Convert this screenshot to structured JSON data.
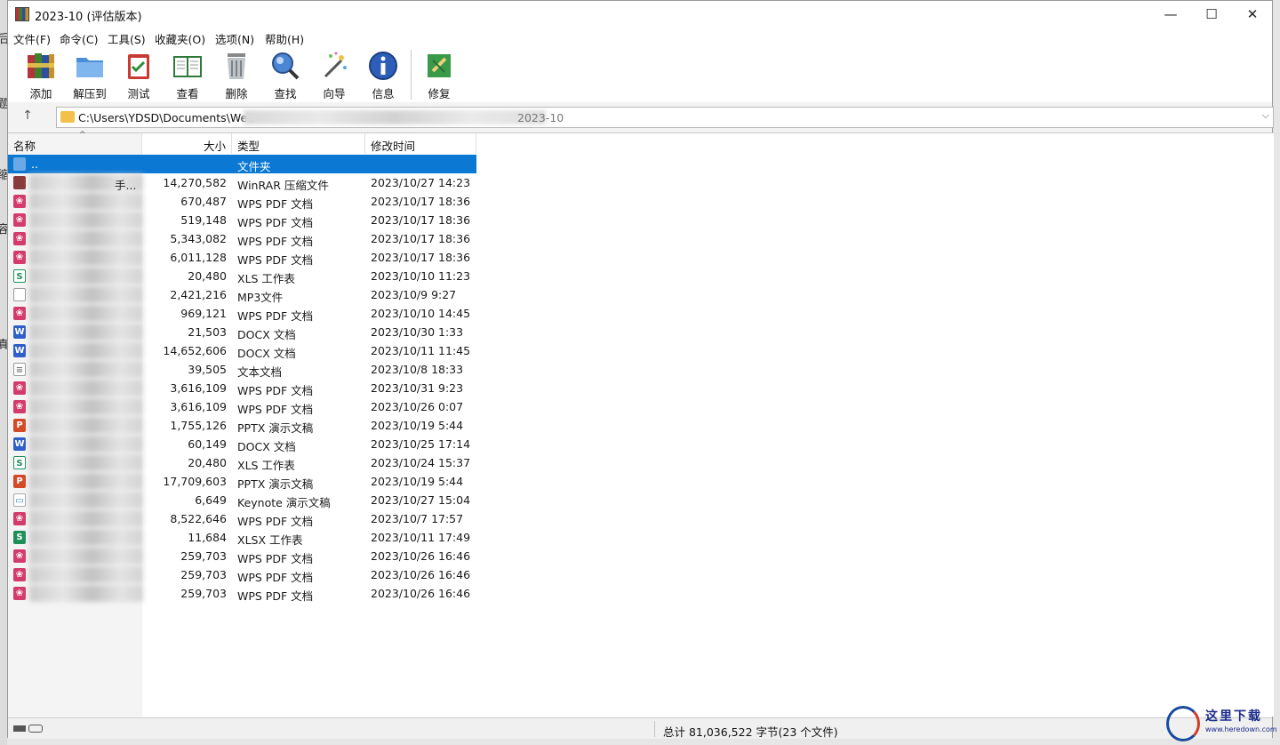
{
  "window": {
    "title": "2023-10 (评估版本)",
    "controls": {
      "minimize": "—",
      "maximize": "☐",
      "close": "✕"
    }
  },
  "background_chars": [
    "后",
    "题",
    "缩",
    "容",
    "真"
  ],
  "menu": [
    "文件(F)",
    "命令(C)",
    "工具(S)",
    "收藏夹(O)",
    "选项(N)",
    "帮助(H)"
  ],
  "toolbar": [
    {
      "label": "添加",
      "icon": "winrar-books-icon"
    },
    {
      "label": "解压到",
      "icon": "extract-folder-icon"
    },
    {
      "label": "测试",
      "icon": "test-clipboard-icon"
    },
    {
      "label": "查看",
      "icon": "view-book-icon"
    },
    {
      "label": "删除",
      "icon": "trash-icon"
    },
    {
      "label": "查找",
      "icon": "search-magnifier-icon"
    },
    {
      "label": "向导",
      "icon": "wizard-wand-icon"
    },
    {
      "label": "信息",
      "icon": "info-icon"
    },
    {
      "label": "修复",
      "icon": "repair-kit-icon"
    }
  ],
  "address": {
    "path": "C:\\Users\\YDSD\\Documents\\WeC",
    "path_tail": "2023-10"
  },
  "columns": {
    "name": "名称",
    "size": "大小",
    "type": "类型",
    "modified": "修改时间"
  },
  "files": [
    {
      "name": "..",
      "size": "",
      "type": "文件夹",
      "modified": "",
      "icon": "folder-icon",
      "selected": true
    },
    {
      "name": "手...",
      "size": "14,270,582",
      "type": "WinRAR 压缩文件",
      "modified": "2023/10/27 14:23",
      "icon": "rar-file-icon"
    },
    {
      "name": "",
      "size": "670,487",
      "type": "WPS PDF 文档",
      "modified": "2023/10/17 18:36",
      "icon": "pdf-file-icon"
    },
    {
      "name": "",
      "size": "519,148",
      "type": "WPS PDF 文档",
      "modified": "2023/10/17 18:36",
      "icon": "pdf-file-icon"
    },
    {
      "name": "",
      "size": "5,343,082",
      "type": "WPS PDF 文档",
      "modified": "2023/10/17 18:36",
      "icon": "pdf-file-icon"
    },
    {
      "name": "",
      "size": "6,011,128",
      "type": "WPS PDF 文档",
      "modified": "2023/10/17 18:36",
      "icon": "pdf-file-icon"
    },
    {
      "name": "",
      "size": "20,480",
      "type": "XLS 工作表",
      "modified": "2023/10/10 11:23",
      "icon": "xls-file-icon"
    },
    {
      "name": "",
      "size": "2,421,216",
      "type": "MP3文件",
      "modified": "2023/10/9 9:27",
      "icon": "blank-file-icon"
    },
    {
      "name": "",
      "size": "969,121",
      "type": "WPS PDF 文档",
      "modified": "2023/10/10 14:45",
      "icon": "pdf-file-icon"
    },
    {
      "name": "",
      "size": "21,503",
      "type": "DOCX 文档",
      "modified": "2023/10/30 1:33",
      "icon": "docx-file-icon"
    },
    {
      "name": "",
      "size": "14,652,606",
      "type": "DOCX 文档",
      "modified": "2023/10/11 11:45",
      "icon": "docx-file-icon"
    },
    {
      "name": "",
      "size": "39,505",
      "type": "文本文档",
      "modified": "2023/10/8 18:33",
      "icon": "text-file-icon"
    },
    {
      "name": "",
      "size": "3,616,109",
      "type": "WPS PDF 文档",
      "modified": "2023/10/31 9:23",
      "icon": "pdf-file-icon"
    },
    {
      "name": "",
      "size": "3,616,109",
      "type": "WPS PDF 文档",
      "modified": "2023/10/26 0:07",
      "icon": "pdf-file-icon"
    },
    {
      "name": "",
      "size": "1,755,126",
      "type": "PPTX 演示文稿",
      "modified": "2023/10/19 5:44",
      "icon": "pptx-file-icon"
    },
    {
      "name": "",
      "size": "60,149",
      "type": "DOCX 文档",
      "modified": "2023/10/25 17:14",
      "icon": "docx-file-icon"
    },
    {
      "name": "",
      "size": "20,480",
      "type": "XLS 工作表",
      "modified": "2023/10/24 15:37",
      "icon": "xls-file-icon"
    },
    {
      "name": "",
      "size": "17,709,603",
      "type": "PPTX 演示文稿",
      "modified": "2023/10/19 5:44",
      "icon": "pptx-file-icon"
    },
    {
      "name": "",
      "size": "6,649",
      "type": "Keynote 演示文稿",
      "modified": "2023/10/27 15:04",
      "icon": "keynote-file-icon"
    },
    {
      "name": "",
      "size": "8,522,646",
      "type": "WPS PDF 文档",
      "modified": "2023/10/7 17:57",
      "icon": "pdf-file-icon"
    },
    {
      "name": "",
      "size": "11,684",
      "type": "XLSX 工作表",
      "modified": "2023/10/11 17:49",
      "icon": "xlsx-file-icon"
    },
    {
      "name": "",
      "size": "259,703",
      "type": "WPS PDF 文档",
      "modified": "2023/10/26 16:46",
      "icon": "pdf-file-icon"
    },
    {
      "name": "",
      "size": "259,703",
      "type": "WPS PDF 文档",
      "modified": "2023/10/26 16:46",
      "icon": "pdf-file-icon"
    },
    {
      "name": "",
      "size": "259,703",
      "type": "WPS PDF 文档",
      "modified": "2023/10/26 16:46",
      "icon": "pdf-file-icon"
    }
  ],
  "status": {
    "summary": "总计 81,036,522 字节(23 个文件)"
  },
  "watermark": {
    "title": "这里下载",
    "url": "www.heredown.com"
  },
  "colors": {
    "selection": "#0b78d4",
    "pdf": "#d33b6c",
    "docx": "#2f5fc8",
    "xls": "#1f8f5a",
    "pptx": "#d24a26"
  }
}
